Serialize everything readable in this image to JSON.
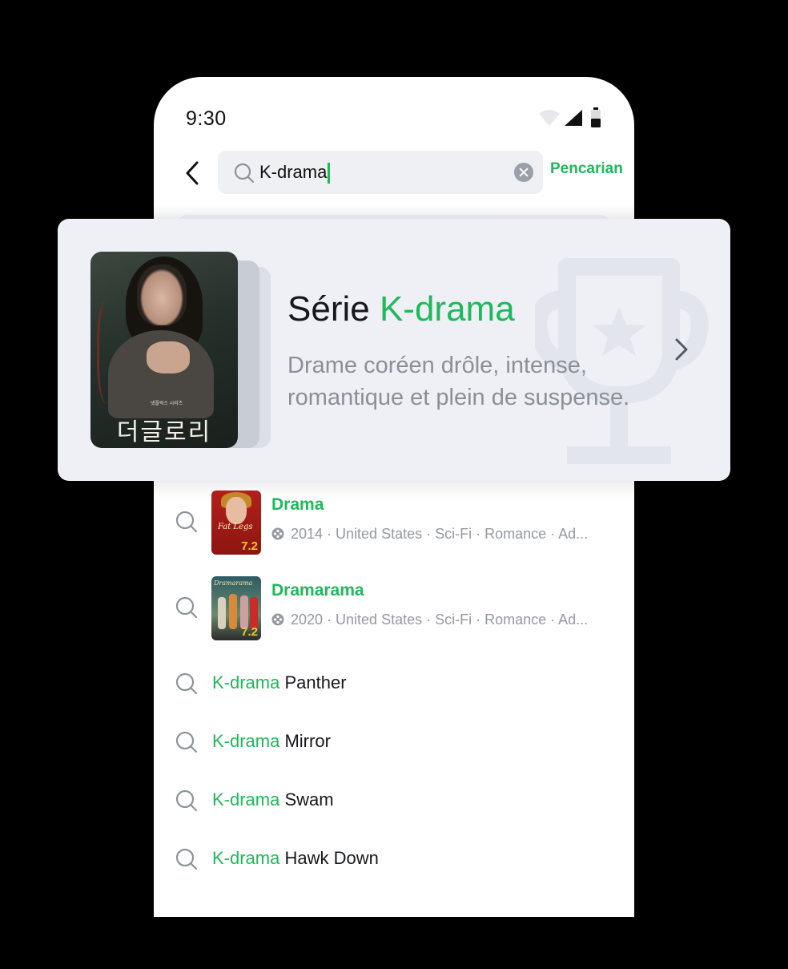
{
  "status_bar": {
    "time": "9:30"
  },
  "search": {
    "query": "K-drama",
    "submit_label": "Pencarian"
  },
  "featured": {
    "title_prefix": "Série ",
    "title_accent": "K-drama",
    "description": "Drame coréen drôle, intense, romantique et plein de suspense.",
    "poster_title": "더글로리",
    "poster_subtitle": "넷플릭스 시리즈"
  },
  "results": [
    {
      "title": "Drama",
      "meta": "2014 · United States · Sci-Fi · Romance · Ad...",
      "score": "7.2",
      "thumb_caption": "Fat Legs"
    },
    {
      "title": "Dramarama",
      "meta": "2020 · United States · Sci-Fi · Romance · Ad...",
      "score": "7.2",
      "thumb_caption": "Dramarama"
    }
  ],
  "suggestions": [
    {
      "accent": "K-drama",
      "rest": " Panther"
    },
    {
      "accent": "K-drama",
      "rest": " Mirror"
    },
    {
      "accent": "K-drama",
      "rest": " Swam"
    },
    {
      "accent": "K-drama",
      "rest": " Hawk Down"
    }
  ],
  "colors": {
    "accent": "#1fb85a",
    "card_background": "#eef0f5",
    "muted_text": "#8a8f98"
  },
  "icons": [
    "wifi-icon",
    "signal-icon",
    "battery-icon",
    "back-arrow-icon",
    "search-icon",
    "clear-icon",
    "trophy-icon",
    "chevron-right-icon",
    "film-reel-icon"
  ]
}
